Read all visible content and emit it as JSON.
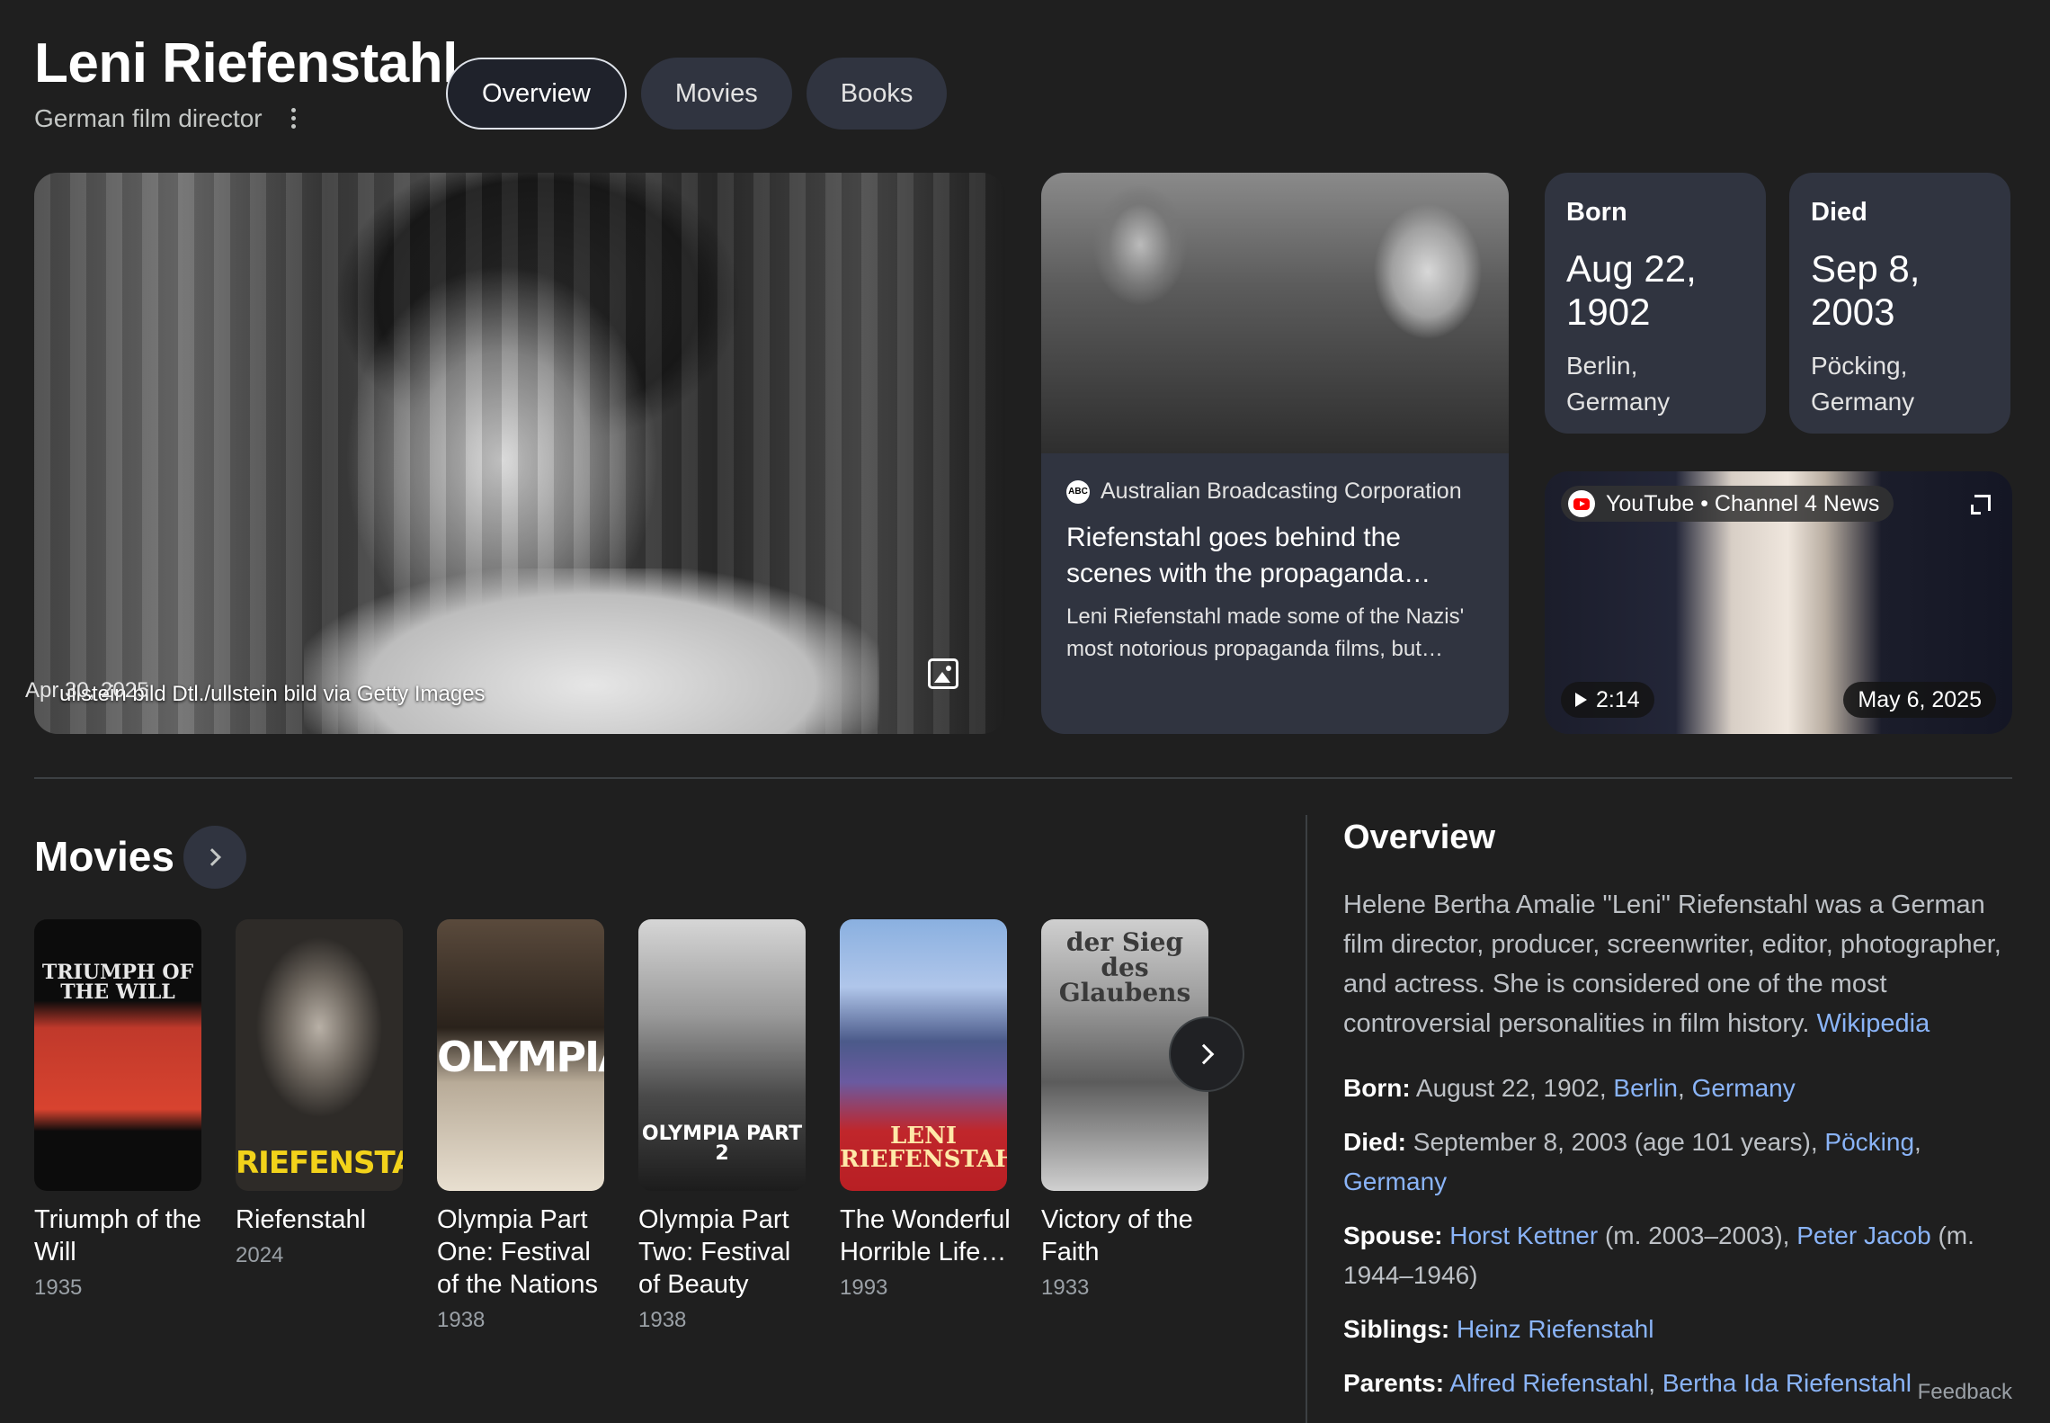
{
  "header": {
    "title": "Leni Riefenstahl",
    "subtitle": "German film director",
    "tabs": [
      {
        "label": "Overview",
        "active": true
      },
      {
        "label": "Movies",
        "active": false
      },
      {
        "label": "Books",
        "active": false
      }
    ]
  },
  "hero": {
    "credit": "ullstein bild Dtl./ullstein bild via Getty Images"
  },
  "news": {
    "source": "Australian Broadcasting Corporation",
    "source_icon_text": "ABC",
    "title": "Riefenstahl goes behind the scenes with the propaganda filmmaker for…",
    "snippet": "Leni Riefenstahl made some of the Nazis' most notorious propaganda films, but…",
    "date": "Apr 30, 2025"
  },
  "born": {
    "label": "Born",
    "date": "Aug 22, 1902",
    "place": "Berlin, Germany"
  },
  "died": {
    "label": "Died",
    "date": "Sep 8, 2003",
    "place": "Pöcking, Germany"
  },
  "video": {
    "source": "YouTube • Channel 4 News",
    "duration": "2:14",
    "date": "May 6, 2025"
  },
  "movies": {
    "heading": "Movies",
    "items": [
      {
        "title": "Triumph of the Will",
        "year": "1935",
        "poster_text": "TRIUMPH OF THE WILL"
      },
      {
        "title": "Riefenstahl",
        "year": "2024",
        "poster_text": "RIEFENSTAHL"
      },
      {
        "title": "Olympia Part One: Festival of the Nations",
        "year": "1938",
        "poster_text": "OLYMPIA"
      },
      {
        "title": "Olympia Part Two: Festival of Beauty",
        "year": "1938",
        "poster_text": "OLYMPIA PART 2"
      },
      {
        "title": "The Wonderful Horrible Life…",
        "year": "1993",
        "poster_text": "LENI RIEFENSTAHL"
      },
      {
        "title": "Victory of the Faith",
        "year": "1933",
        "poster_text": "der Sieg des Glaubens"
      }
    ]
  },
  "overview": {
    "heading": "Overview",
    "description": "Helene Bertha Amalie \"Leni\" Riefenstahl was a German film director, producer, screenwriter, editor, photographer, and actress. She is considered one of the most controversial personalities in film history.",
    "source_link": "Wikipedia",
    "facts": {
      "born": {
        "label": "Born:",
        "text": "August 22, 1902,",
        "link1": "Berlin",
        "sep": ",",
        "link2": "Germany"
      },
      "died": {
        "label": "Died:",
        "text": "September 8, 2003 (age 101 years),",
        "link1": "Pöcking",
        "sep": ",",
        "link2": "Germany"
      },
      "spouse": {
        "label": "Spouse:",
        "link1": "Horst Kettner",
        "text1": "(m. 2003–2003),",
        "link2": "Peter Jacob",
        "text2": "(m. 1944–1946)"
      },
      "siblings": {
        "label": "Siblings:",
        "link1": "Heinz Riefenstahl"
      },
      "parents": {
        "label": "Parents:",
        "link1": "Alfred Riefenstahl",
        "sep": ",",
        "link2": "Bertha Ida Riefenstahl"
      }
    }
  },
  "footer": {
    "feedback": "Feedback"
  },
  "colors": {
    "background": "#1f1f1f",
    "card": "#303440",
    "link": "#8ab4f8"
  }
}
